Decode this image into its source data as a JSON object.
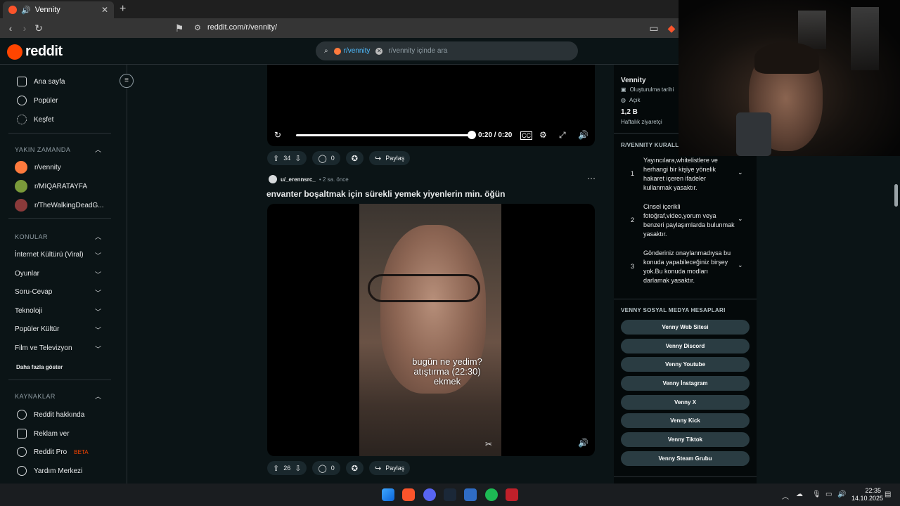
{
  "browser": {
    "tab_title": "Vennity",
    "tab_audio_icon": "speaker-icon",
    "new_tab": "+",
    "url": "reddit.com/r/vennity/"
  },
  "header": {
    "logo_text": "reddit",
    "search_chip": "r/vennity",
    "search_placeholder": "r/vennity içinde ara"
  },
  "leftnav": {
    "items": [
      {
        "label": "Ana sayfa",
        "icon": "home-icon"
      },
      {
        "label": "Popüler",
        "icon": "popular-icon"
      },
      {
        "label": "Keşfet",
        "icon": "explore-icon"
      }
    ],
    "recent_title": "YAKIN ZAMANDA",
    "recent": [
      {
        "label": "r/vennity",
        "color": "#ff7a3d"
      },
      {
        "label": "r/MIQARATAYFA",
        "color": "#7a9a3a"
      },
      {
        "label": "r/TheWalkingDeadG...",
        "color": "#8a3a3a"
      }
    ],
    "topics_title": "KONULAR",
    "topics": [
      "İnternet Kültürü (Viral)",
      "Oyunlar",
      "Soru-Cevap",
      "Teknoloji",
      "Popüler Kültür",
      "Film ve Televizyon"
    ],
    "show_more": "Daha fazla göster",
    "resources_title": "KAYNAKLAR",
    "resources": [
      {
        "label": "Reddit hakkında",
        "icon": "reddit-icon"
      },
      {
        "label": "Reklam ver",
        "icon": "megaphone-icon"
      },
      {
        "label": "Reddit Pro",
        "badge": "BETA",
        "icon": "pro-icon"
      },
      {
        "label": "Yardım Merkezi",
        "icon": "help-icon"
      }
    ]
  },
  "post1": {
    "time": "0:20 / 0:20",
    "votes": "34",
    "comments": "0",
    "share": "Paylaş"
  },
  "post2": {
    "author": "u/_erennsrc_",
    "age": "• 2 sa. önce",
    "title": "envanter boşaltmak için sürekli yemek yiyenlerin min. öğün",
    "overlay_lines": [
      "bugün ne yedim?",
      "atıştırma (22:30)",
      "ekmek"
    ],
    "votes": "26",
    "comments": "0",
    "share": "Paylaş"
  },
  "sidebar": {
    "name": "Vennity",
    "created": "Oluşturulma tarihi",
    "visibility": "Açık",
    "visitors": "1,2 B",
    "visitors_label": "Haftalık ziyaretçi",
    "rules_title": "R/VENNITY KURALLAR",
    "rules": [
      {
        "num": "1",
        "text": "Yayıncılara,whitelistlere ve herhangi bir kişiye yönelik hakaret içeren ifadeler kullanmak yasaktır."
      },
      {
        "num": "2",
        "text": "Cinsel içerikli fotoğraf,video,yorum veya benzeri paylaşımlarda bulunmak yasaktır."
      },
      {
        "num": "3",
        "text": "Gönderiniz onaylanmadıysa bu konuda yapabileceğiniz birşey yok.Bu konuda modları darlamak yasaktır."
      }
    ],
    "social_title": "VENNY SOSYAL MEDYA HESAPLARI",
    "social_buttons": [
      "Venny Web Sitesi",
      "Venny Discord",
      "Venny Youtube",
      "Venny İnstagram",
      "Venny X",
      "Venny Kick",
      "Venny Tiktok",
      "Venny Steam Grubu"
    ]
  },
  "taskbar": {
    "time": "22:35",
    "date": "14.10.2025"
  },
  "colors": {
    "reddit_orange": "#ff4500",
    "bg": "#0b1416",
    "button": "#2a3c42"
  }
}
